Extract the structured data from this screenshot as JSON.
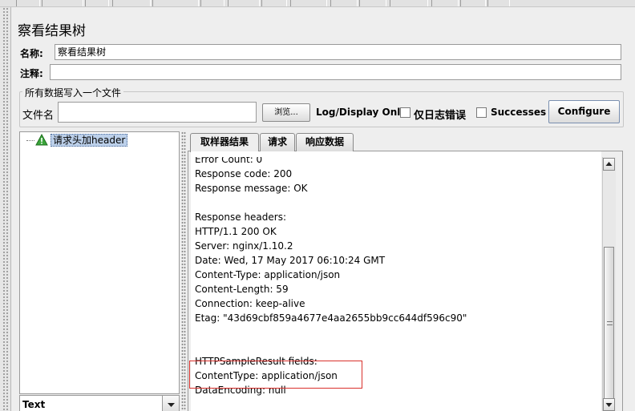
{
  "panel": {
    "title": "察看结果树"
  },
  "name_field": {
    "label": "名称:",
    "value": "察看结果树"
  },
  "comment_field": {
    "label": "注释:",
    "value": ""
  },
  "file_section": {
    "title": "所有数据写入一个文件",
    "filename_label": "文件名",
    "filename_value": "",
    "browse_label": "浏览...",
    "log_display_label": "Log/Display Only:",
    "errors_only_label": "仅日志错误",
    "successes_label": "Successes",
    "configure_label": "Configure"
  },
  "tree": {
    "items": [
      {
        "label": "请求头加header"
      }
    ]
  },
  "renderer": {
    "selected": "Text"
  },
  "tabs": [
    {
      "label": "取样器结果",
      "active": true
    },
    {
      "label": "请求",
      "active": false
    },
    {
      "label": "响应数据",
      "active": false
    }
  ],
  "response_lines": [
    "Error Count: 0",
    "Response code: 200",
    "Response message: OK",
    "",
    "Response headers:",
    "HTTP/1.1 200 OK",
    "Server: nginx/1.10.2",
    "Date: Wed, 17 May 2017 06:10:24 GMT",
    "Content-Type: application/json",
    "Content-Length: 59",
    "Connection: keep-alive",
    "Etag: \"43d69cbf859a4677e4aa2655bb9cc644df596c90\"",
    "",
    "",
    "HTTPSampleResult fields:",
    "ContentType: application/json",
    "DataEncoding: null"
  ],
  "icons": {
    "tree_node": "warning-triangle-icon",
    "scroll_up": "arrow-up-icon",
    "scroll_down": "arrow-down-icon",
    "dropdown": "chevron-down-icon"
  },
  "colors": {
    "highlight": "#d9302c",
    "selection": "#bcd0ea",
    "tree_icon": "#3aa53a"
  }
}
